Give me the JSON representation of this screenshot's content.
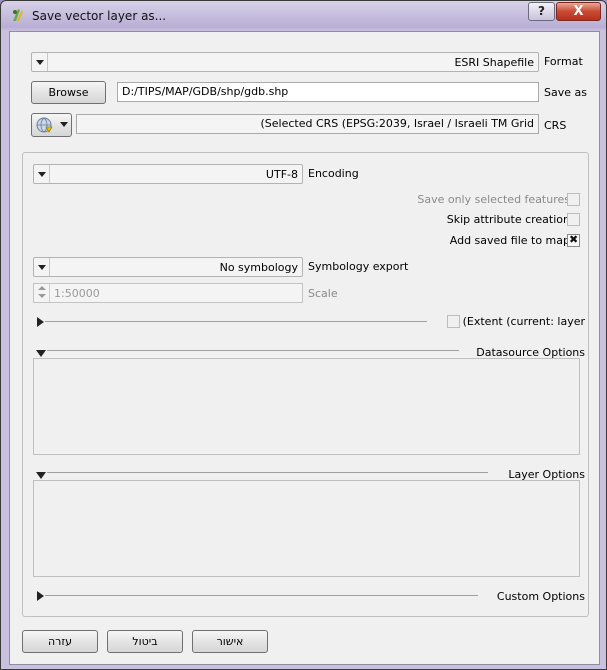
{
  "window": {
    "title": "Save vector layer as...",
    "help_label": "?",
    "close_label": "X"
  },
  "format": {
    "value": "ESRI Shapefile",
    "label": "Format"
  },
  "save_as": {
    "browse_label": "Browse",
    "path": "D:/TIPS/MAP/GDB/shp/gdb.shp",
    "label": "Save as"
  },
  "crs": {
    "value": "(Selected CRS (EPSG:2039, Israel / Israeli TM Grid",
    "label": "CRS"
  },
  "encoding": {
    "value": "UTF-8",
    "label": "Encoding"
  },
  "options": {
    "save_only_selected": {
      "label": "Save only selected features",
      "checked": false,
      "enabled": false
    },
    "skip_attribute_creation": {
      "label": "Skip attribute creation",
      "checked": false,
      "enabled": true
    },
    "add_saved_file": {
      "label": "Add saved file to map",
      "checked": true,
      "enabled": true
    }
  },
  "symbology": {
    "value": "No symbology",
    "label": "Symbology export"
  },
  "scale": {
    "value": "1:50000",
    "label": "Scale"
  },
  "extent": {
    "label": "(Extent (current: layer"
  },
  "sections": {
    "datasource_options": "Datasource Options",
    "layer_options": "Layer Options",
    "custom_options": "Custom Options"
  },
  "buttons": {
    "help": "עזרה",
    "cancel": "ביטול",
    "ok": "אישור"
  }
}
